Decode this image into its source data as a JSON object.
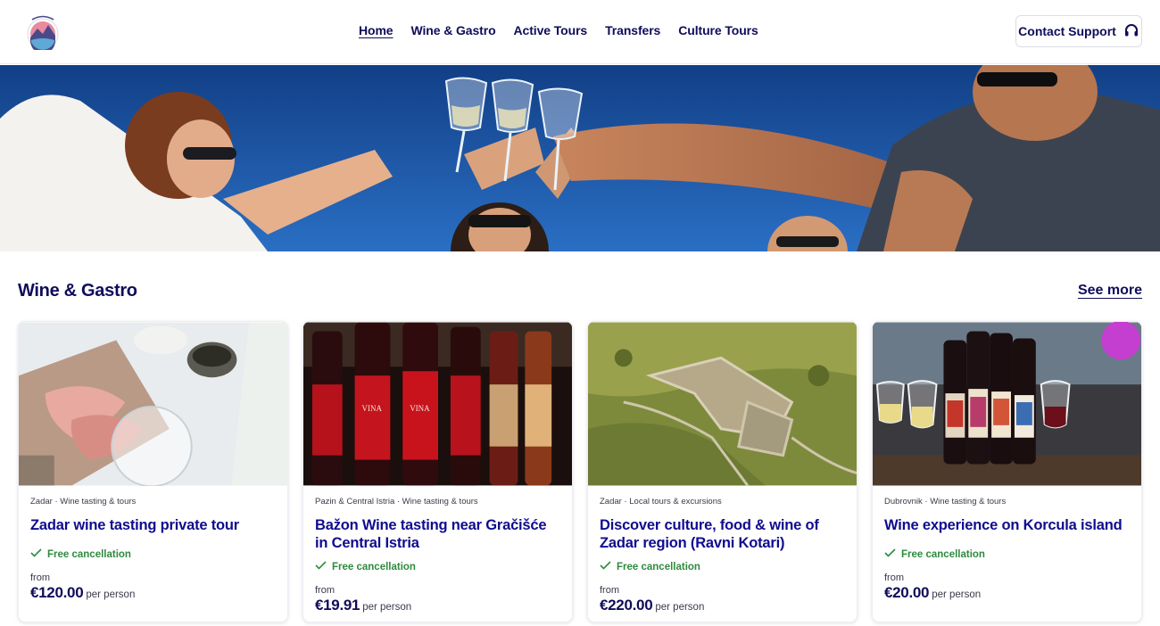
{
  "header": {
    "logo_alt": "Glimpsing Routes",
    "nav": [
      "Home",
      "Wine & Gastro",
      "Active Tours",
      "Transfers",
      "Culture Tours"
    ],
    "active_nav": "Home",
    "contact_label": "Contact Support"
  },
  "section": {
    "title": "Wine & Gastro",
    "see_more": "See more"
  },
  "cards": [
    {
      "location": "Zadar",
      "category": "Wine tasting & tours",
      "meta": "Zadar · Wine tasting & tours",
      "title": "Zadar wine tasting private tour",
      "free_cancel": "Free cancellation",
      "from_label": "from",
      "price": "€120.00",
      "per": "per person"
    },
    {
      "location": "Pazin & Central Istria",
      "category": "Wine tasting & tours",
      "meta": "Pazin & Central Istria · Wine tasting & tours",
      "title": "Bažon Wine tasting near Gračišće in Central Istria",
      "free_cancel": "Free cancellation",
      "from_label": "from",
      "price": "€19.91",
      "per": "per person"
    },
    {
      "location": "Zadar",
      "category": "Local tours & excursions",
      "meta": "Zadar · Local tours & excursions",
      "title": "Discover culture, food & wine of Zadar region (Ravni Kotari)",
      "free_cancel": "Free cancellation",
      "from_label": "from",
      "price": "€220.00",
      "per": "per person"
    },
    {
      "location": "Dubrovnik",
      "category": "Wine tasting & tours",
      "meta": "Dubrovnik · Wine tasting & tours",
      "title": "Wine experience on Korcula island",
      "free_cancel": "Free cancellation",
      "from_label": "from",
      "price": "€20.00",
      "per": "per person"
    }
  ],
  "icons": {
    "contact": "headset-icon",
    "free_cancel": "checkmark-icon"
  },
  "colors": {
    "brand_navy": "#0f0c5a",
    "title_blue": "#0f0c8e",
    "success_green": "#2f8a3e"
  }
}
